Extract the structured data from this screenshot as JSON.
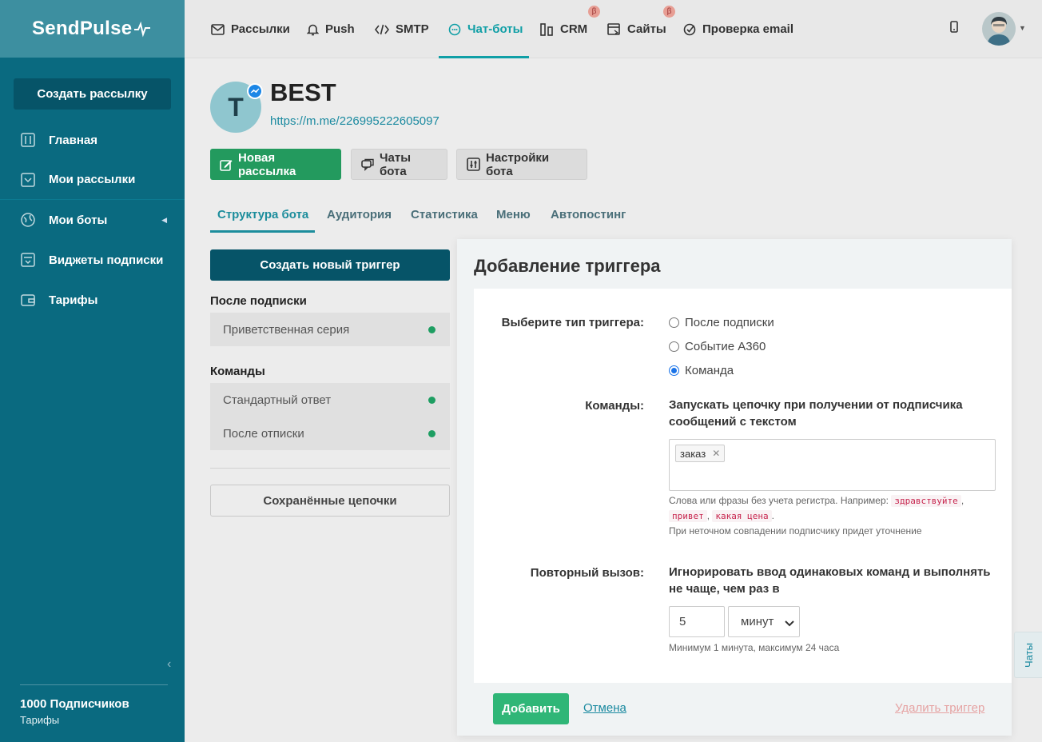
{
  "app": {
    "logo": "SendPulse"
  },
  "sidebar": {
    "create_button": "Создать рассылку",
    "items": [
      {
        "label": "Главная",
        "icon": "sliders-icon"
      },
      {
        "label": "Мои рассылки",
        "icon": "inbox-icon"
      },
      {
        "label": "Мои боты",
        "icon": "globe-icon"
      },
      {
        "label": "Виджеты подписки",
        "icon": "widget-icon"
      },
      {
        "label": "Тарифы",
        "icon": "wallet-icon"
      }
    ],
    "subscribers": "1000 Подписчиков",
    "tariffs_link": "Тарифы"
  },
  "topnav": {
    "items": [
      {
        "label": "Рассылки",
        "icon": "mail-icon"
      },
      {
        "label": "Push",
        "icon": "bell-icon"
      },
      {
        "label": "SMTP",
        "icon": "code-icon"
      },
      {
        "label": "Чат-боты",
        "icon": "chat-icon",
        "active": true
      },
      {
        "label": "CRM",
        "icon": "crm-icon",
        "beta": "β"
      },
      {
        "label": "Сайты",
        "icon": "site-icon",
        "beta": "β"
      },
      {
        "label": "Проверка email",
        "icon": "check-icon"
      }
    ]
  },
  "bot": {
    "initial": "T",
    "name": "BEST",
    "link": "https://m.me/226995222605097",
    "buttons": {
      "new_mailing": "Новая рассылка",
      "bot_chats": "Чаты бота",
      "bot_settings": "Настройки бота"
    },
    "tabs": [
      "Структура бота",
      "Аудитория",
      "Статистика",
      "Меню",
      "Автопостинг"
    ]
  },
  "triggers": {
    "create_button": "Создать новый триггер",
    "after_subscribe_title": "После подписки",
    "after_subscribe_items": [
      "Приветственная серия"
    ],
    "commands_title": "Команды",
    "commands_items": [
      "Стандартный ответ",
      "После отписки"
    ],
    "saved_button": "Сохранённые цепочки"
  },
  "modal": {
    "title": "Добавление триггера",
    "type_label": "Выберите тип триггера:",
    "type_options": [
      "После подписки",
      "Событие A360",
      "Команда"
    ],
    "selected_type": "Команда",
    "commands_label": "Команды:",
    "commands_desc": "Запускать цепочку при получении от подписчика сообщений с текстом",
    "tags": [
      "заказ"
    ],
    "hint_prefix": "Слова или фразы без учета регистра. Например:",
    "examples": [
      "здравствуйте",
      "привет",
      "какая цена"
    ],
    "hint_suffix": "При неточном совпадении подписчику придет уточнение",
    "repeat_label": "Повторный вызов:",
    "repeat_desc": "Игнорировать ввод одинаковых команд и выполнять не чаще, чем раз в",
    "repeat_value": "5",
    "repeat_unit": "минут",
    "repeat_hint": "Минимум 1 минута, максимум 24 часа",
    "add_button": "Добавить",
    "cancel_link": "Отмена",
    "delete_link": "Удалить триггер"
  },
  "chats_tab": "Чаты",
  "colors": {
    "sidebar": "#0a6a80",
    "accent": "#109fa6",
    "green": "#2fb677",
    "dark_button": "#065468"
  }
}
